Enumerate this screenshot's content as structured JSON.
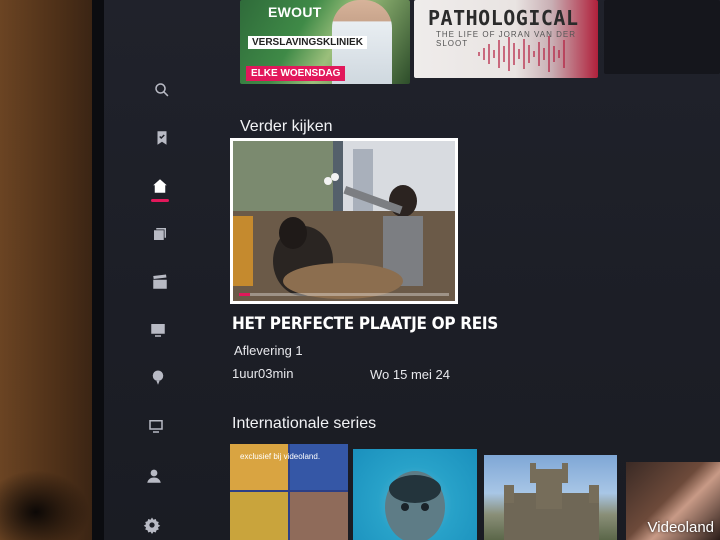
{
  "top_row": {
    "card1": {
      "title": "EWOUT",
      "subtitle": "VERSLAVINGSKLINIEK",
      "badge": "ELKE WOENSDAG"
    },
    "card2": {
      "title": "PATHOLOGICAL",
      "subtitle": "THE LIFE OF JORAN VAN DER SLOOT"
    }
  },
  "sections": {
    "continue_watching": {
      "title": "Verder kijken",
      "item": {
        "title": "HET PERFECTE PLAATJE OP REIS",
        "episode": "Aflevering 1",
        "duration": "1uur03min",
        "date": "Wo 15 mei 24",
        "progress": 0.05
      }
    },
    "international_series": {
      "title": "Internationale series",
      "card1_tag": "exclusief bij videoland."
    }
  },
  "watermark": "Videoland",
  "colors": {
    "accent": "#e2185b",
    "screen_bg": "#1e2028"
  },
  "sidebar": {
    "items": [
      {
        "icon": "search-icon",
        "active": false
      },
      {
        "icon": "bookmark-icon",
        "active": false
      },
      {
        "icon": "home-icon",
        "active": true
      },
      {
        "icon": "series-icon",
        "active": false
      },
      {
        "icon": "clapperboard-icon",
        "active": false
      },
      {
        "icon": "tv-program-icon",
        "active": false
      },
      {
        "icon": "kids-balloon-icon",
        "active": false
      },
      {
        "icon": "live-tv-icon",
        "active": false
      },
      {
        "icon": "profile-icon",
        "active": false
      },
      {
        "icon": "settings-icon",
        "active": false
      }
    ]
  }
}
